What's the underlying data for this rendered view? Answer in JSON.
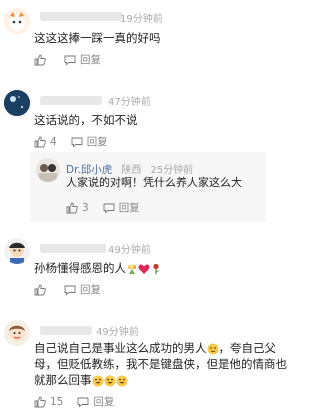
{
  "comments": [
    {
      "time": "19分钟前",
      "text": "这这这捧一踩一真的好吗",
      "like_count": "",
      "reply_label": "回复"
    },
    {
      "time": "47分钟前",
      "text": "这话说的，不如不说",
      "like_count": "4",
      "reply_label": "回复",
      "reply": {
        "name": "Dr.邱小虎",
        "location": "陕西",
        "time": "25分钟前",
        "text": "人家说的对啊！凭什么养人家这么大",
        "like_count": "3",
        "reply_label": "回复"
      }
    },
    {
      "time": "49分钟前",
      "text": "孙杨懂得感恩的人",
      "like_count": "",
      "reply_label": "回复"
    },
    {
      "time": "49分钟前",
      "text_line1": "自己说自己是事业这么成功的男人",
      "text_line1_tail": "，夸自己父",
      "text_line2": "母，但贬低教练，我不是键盘侠，但是他的情商也",
      "text_line3": "就那么回事",
      "like_count": "15",
      "reply_label": "回复"
    }
  ]
}
